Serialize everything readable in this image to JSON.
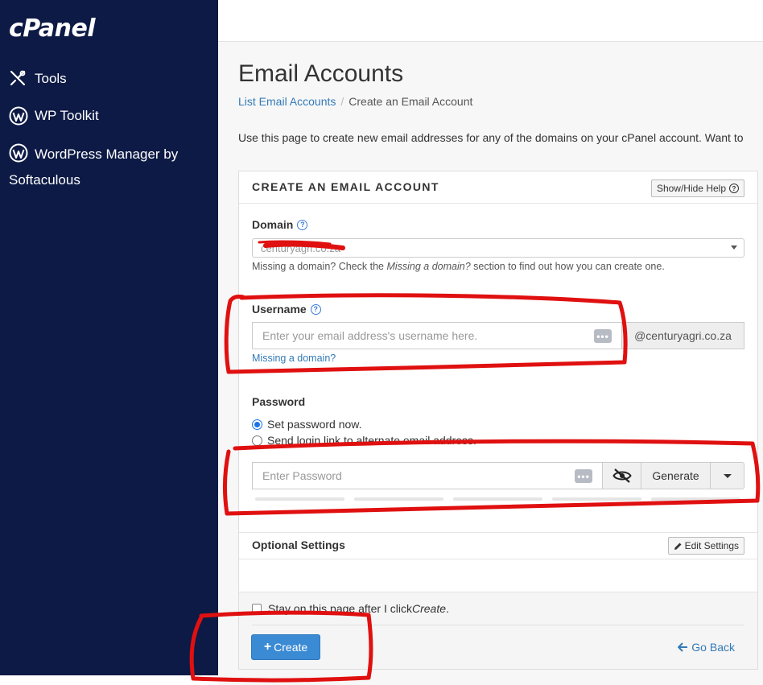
{
  "sidebar": {
    "logo": "cPanel",
    "items": [
      {
        "label": "Tools"
      },
      {
        "label": "WP Toolkit"
      },
      {
        "label": "WordPress Manager by Softaculous"
      }
    ]
  },
  "page": {
    "title": "Email Accounts",
    "breadcrumb": {
      "parent": "List Email Accounts",
      "current": "Create an Email Account"
    },
    "intro": "Use this page to create new email addresses for any of the domains on your cPanel account. Want to"
  },
  "form": {
    "panel_title": "CREATE AN EMAIL ACCOUNT",
    "show_hide_help": "Show/Hide Help",
    "domain": {
      "label": "Domain",
      "value": "centuryagri.co.za",
      "hint_pre": "Missing a domain? Check the ",
      "hint_em": "Missing a domain?",
      "hint_post": " section to find out how you can create one."
    },
    "username": {
      "label": "Username",
      "placeholder": "Enter your email address's username here.",
      "suffix": "@centuryagri.co.za",
      "missing_link": "Missing a domain?"
    },
    "password": {
      "label": "Password",
      "option_set": "Set password now.",
      "option_link": "Send login link to alternate email address.",
      "placeholder": "Enter Password",
      "generate": "Generate"
    },
    "optional": {
      "title": "Optional Settings",
      "edit": "Edit Settings"
    },
    "footer": {
      "stay_pre": "Stay on this page after I click ",
      "stay_em": "Create",
      "stay_post": ".",
      "create": "Create",
      "go_back": "Go Back"
    }
  },
  "colors": {
    "sidebar_bg": "#0d1a45",
    "link": "#337ab7",
    "primary": "#3a8ad4",
    "annotation": "#e01010"
  }
}
